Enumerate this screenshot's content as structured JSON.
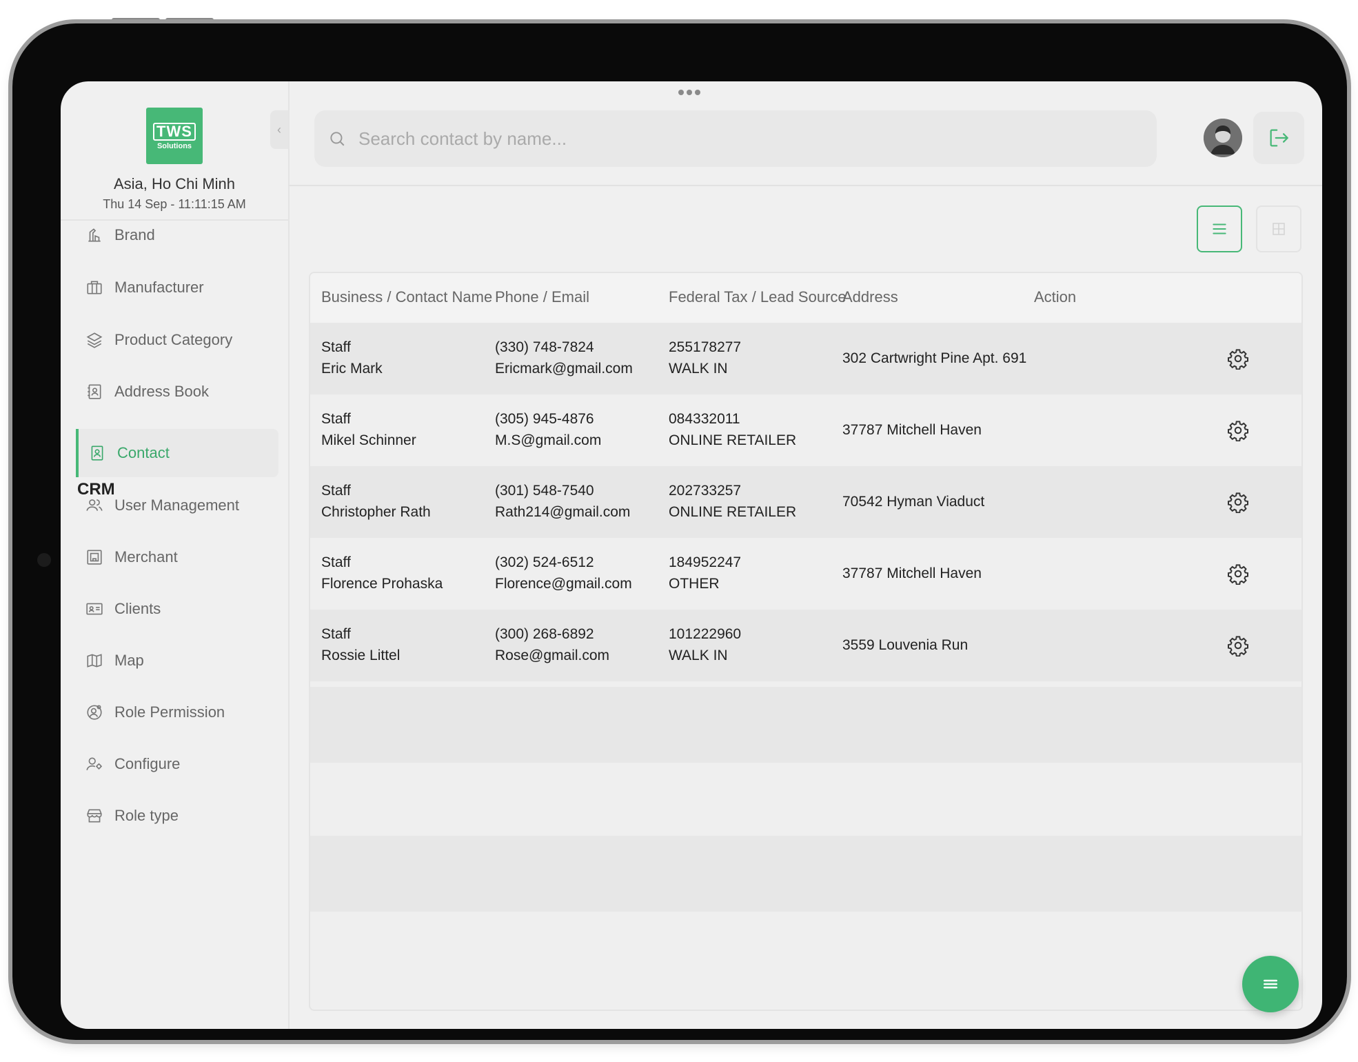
{
  "brand": {
    "logo_main": "TWS",
    "logo_sub": "Solutions",
    "location": "Asia, Ho Chi Minh",
    "datetime": "Thu 14 Sep - 11:11:15 AM"
  },
  "sidebar": {
    "items": [
      {
        "label": "Brand",
        "icon": "brand-icon"
      },
      {
        "label": "Manufacturer",
        "icon": "building-icon"
      },
      {
        "label": "Product Category",
        "icon": "layers-icon"
      },
      {
        "label": "Address Book",
        "icon": "address-book-icon"
      },
      {
        "label": "Contact",
        "icon": "contact-icon",
        "active": true
      },
      {
        "label": "User Management",
        "icon": "users-icon"
      },
      {
        "label": "Merchant",
        "icon": "merchant-icon"
      },
      {
        "label": "Clients",
        "icon": "id-card-icon"
      },
      {
        "label": "Map",
        "icon": "map-icon"
      },
      {
        "label": "Role Permission",
        "icon": "role-permission-icon"
      },
      {
        "label": "Configure",
        "icon": "user-gear-icon"
      },
      {
        "label": "Role type",
        "icon": "store-icon"
      }
    ],
    "section_crm": "CRM"
  },
  "search": {
    "placeholder": "Search contact by name..."
  },
  "table": {
    "headers": [
      "Business / Contact Name",
      "Phone / Email",
      "Federal Tax / Lead Source",
      "Address",
      "Action"
    ],
    "rows": [
      {
        "business": "Staff",
        "name": "Eric Mark",
        "phone": "(330) 748-7824",
        "email": "Ericmark@gmail.com",
        "tax": "255178277",
        "lead": "WALK IN",
        "address": "302 Cartwright Pine Apt. 691"
      },
      {
        "business": "Staff",
        "name": "Mikel Schinner",
        "phone": "(305) 945-4876",
        "email": "M.S@gmail.com",
        "tax": "084332011",
        "lead": "ONLINE RETAILER",
        "address": "37787 Mitchell Haven"
      },
      {
        "business": "Staff",
        "name": "Christopher Rath",
        "phone": "(301) 548-7540",
        "email": "Rath214@gmail.com",
        "tax": "202733257",
        "lead": "ONLINE RETAILER",
        "address": "70542 Hyman Viaduct"
      },
      {
        "business": "Staff",
        "name": "Florence Prohaska",
        "phone": "(302) 524-6512",
        "email": "Florence@gmail.com",
        "tax": "184952247",
        "lead": "OTHER",
        "address": "37787 Mitchell Haven"
      },
      {
        "business": "Staff",
        "name": "Rossie Littel",
        "phone": "(300) 268-6892",
        "email": "Rose@gmail.com",
        "tax": "101222960",
        "lead": "WALK IN",
        "address": "3559 Louvenia Run"
      }
    ]
  },
  "colors": {
    "accent": "#47b877",
    "screen_bg": "#f0f0f0",
    "row_shade": "#e7e7e7"
  }
}
